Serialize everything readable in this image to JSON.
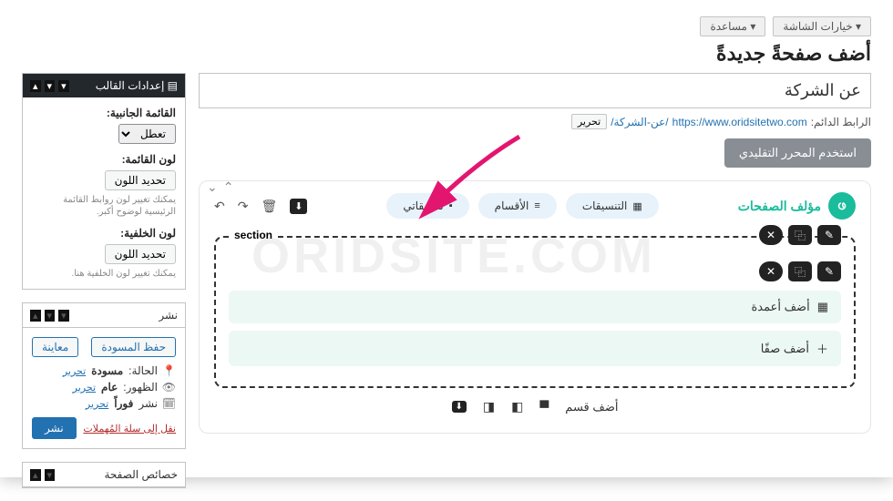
{
  "topbar": {
    "help": "مساعدة ▾",
    "screen_options": "خيارات الشاشة ▾"
  },
  "page_title": "أضف صفحةً جديدةً",
  "title_input": "عن الشركة",
  "permalink": {
    "label": "الرابط الدائم:",
    "base": "https://www.oridsitetwo.com",
    "slug": "/عن-الشركة/",
    "edit": "تحرير"
  },
  "classic_editor_btn": "استخدم المحرر التقليدي",
  "builder": {
    "brand": "مؤلف الصفحات",
    "tabs": {
      "formats": "التنسيقات",
      "sections": "الأقسام",
      "my_formats": "تنسيقاتي"
    },
    "section_label": "section",
    "add_cols": "أضف أعمدة",
    "add_row": "أضف صفًا",
    "add_section": "أضف قسم"
  },
  "sidebar": {
    "template": {
      "title": "إعدادات القالب",
      "side_menu_label": "القائمة الجانبية:",
      "side_menu_value": "تعطل",
      "menu_color_label": "لون القائمة:",
      "bg_color_label": "لون الخلفية:",
      "pick_color": "تحديد اللون",
      "hint1": "يمكنك تغيير لون روابط القائمة الرئيسية لوضوح أكبر.",
      "hint2": "يمكنك تغيير لون الخلفية هنا."
    },
    "publish": {
      "title": "نشر",
      "save_draft": "حفظ المسودة",
      "preview": "معاينة",
      "status_label": "الحالة:",
      "status_val": "مسودة",
      "edit": "تحرير",
      "visibility_label": "الظهور:",
      "visibility_val": "عام",
      "schedule_label": "نشر",
      "schedule_val": "فوراً",
      "trash": "نقل إلى سلة المُهملات",
      "publish_btn": "نشر"
    },
    "page_attrs": "خصائص الصفحة"
  },
  "watermark": "ORIDSITE.COM"
}
